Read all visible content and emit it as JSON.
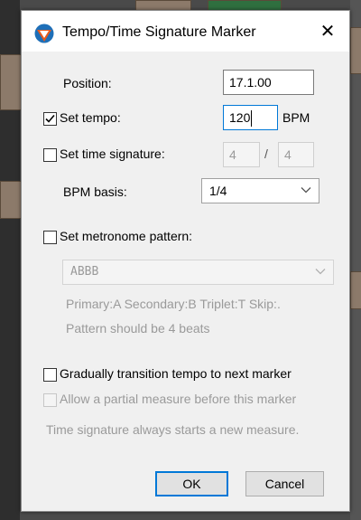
{
  "window": {
    "title": "Tempo/Time Signature Marker",
    "close_glyph": "✕"
  },
  "position": {
    "label": "Position:",
    "value": "17.1.00"
  },
  "set_tempo": {
    "label": "Set tempo:",
    "checked": true,
    "value": "120",
    "unit": "BPM"
  },
  "set_time_signature": {
    "label": "Set time signature:",
    "checked": false,
    "numerator": "4",
    "separator": "/",
    "denominator": "4"
  },
  "bpm_basis": {
    "label": "BPM basis:",
    "value": "1/4"
  },
  "metronome": {
    "label": "Set metronome pattern:",
    "checked": false,
    "pattern": "ABBB",
    "hint_line1": "Primary:A Secondary:B Triplet:T Skip:.",
    "hint_line2": "Pattern should be 4 beats"
  },
  "gradual": {
    "label": "Gradually transition tempo to next marker",
    "checked": false
  },
  "partial": {
    "label": "Allow a partial measure before this marker",
    "checked": false,
    "enabled": false
  },
  "note": "Time signature always starts a new measure.",
  "buttons": {
    "ok": "OK",
    "cancel": "Cancel"
  },
  "colors": {
    "accent": "#0078d7",
    "disabled_text": "#9a9a9a",
    "dialog_bg": "#f0f0f0"
  }
}
